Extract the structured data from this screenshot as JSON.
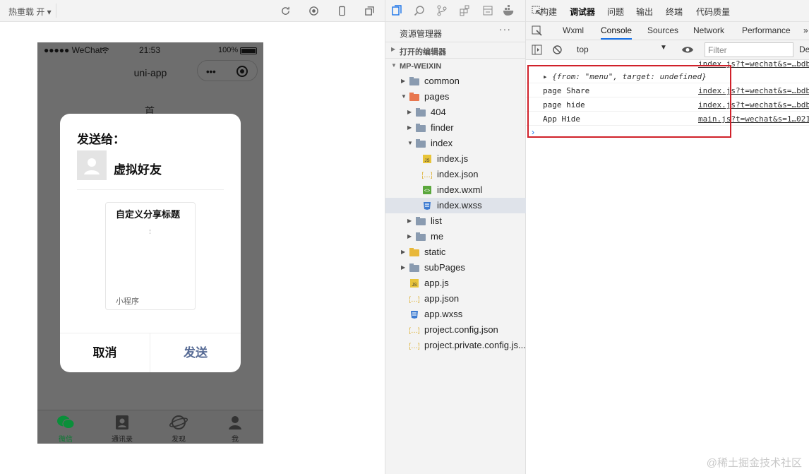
{
  "simulator": {
    "hot_reload": "热重载 开 ▾",
    "phone": {
      "status": {
        "carrier": "●●●●● WeChat",
        "time": "21:53",
        "battery": "100%"
      },
      "nav_title": "uni-app",
      "peek_text": "首",
      "dialog": {
        "title": "发送给：",
        "friend": "虚拟好友",
        "card_title": "自定义分享标题",
        "card_type": "小程序",
        "cancel": "取消",
        "send": "发送"
      },
      "tabbar": [
        {
          "label": "微信",
          "icon": "wechat-icon"
        },
        {
          "label": "通讯录",
          "icon": "contacts-icon"
        },
        {
          "label": "发现",
          "icon": "discover-icon"
        },
        {
          "label": "我",
          "icon": "me-icon"
        }
      ]
    }
  },
  "explorer": {
    "title": "资源管理器",
    "more": "···",
    "open_editors": "打开的编辑器",
    "project": "MP-WEIXIN",
    "tree": [
      {
        "name": "common",
        "depth": 0,
        "type": "folder",
        "open": false
      },
      {
        "name": "pages",
        "depth": 0,
        "type": "folder-special",
        "open": true
      },
      {
        "name": "404",
        "depth": 1,
        "type": "folder",
        "open": false
      },
      {
        "name": "finder",
        "depth": 1,
        "type": "folder",
        "open": false
      },
      {
        "name": "index",
        "depth": 1,
        "type": "folder",
        "open": true
      },
      {
        "name": "index.js",
        "depth": 2,
        "type": "js"
      },
      {
        "name": "index.json",
        "depth": 2,
        "type": "json"
      },
      {
        "name": "index.wxml",
        "depth": 2,
        "type": "wxml"
      },
      {
        "name": "index.wxss",
        "depth": 2,
        "type": "wxss",
        "selected": true
      },
      {
        "name": "list",
        "depth": 1,
        "type": "folder",
        "open": false
      },
      {
        "name": "me",
        "depth": 1,
        "type": "folder",
        "open": false
      },
      {
        "name": "static",
        "depth": 0,
        "type": "folder-yellow",
        "open": false
      },
      {
        "name": "subPages",
        "depth": 0,
        "type": "folder",
        "open": false
      },
      {
        "name": "app.js",
        "depth": 0,
        "type": "js"
      },
      {
        "name": "app.json",
        "depth": 0,
        "type": "json"
      },
      {
        "name": "app.wxss",
        "depth": 0,
        "type": "wxss"
      },
      {
        "name": "project.config.json",
        "depth": 0,
        "type": "json"
      },
      {
        "name": "project.private.config.js...",
        "depth": 0,
        "type": "json"
      }
    ]
  },
  "devtools": {
    "top_tabs": [
      "构建",
      "调试器",
      "问题",
      "输出",
      "终端",
      "代码质量"
    ],
    "tabs": [
      "Wxml",
      "Console",
      "Sources",
      "Network",
      "Performance",
      "»"
    ],
    "active_tab": "Console",
    "context": "top",
    "filter_placeholder": "Filter",
    "default_levels": "De",
    "logs": [
      {
        "message": "▸ {from: \"menu\", target: undefined}",
        "source": "index.js?t=wechat&s=…bdb"
      },
      {
        "message": "page Share",
        "source": "index.js?t=wechat&s=…bdb"
      },
      {
        "message": "page hide",
        "source": "index.js?t=wechat&s=…bdb"
      },
      {
        "message": "App Hide",
        "source": "main.js?t=wechat&s=1…021"
      }
    ],
    "prompt": "›",
    "highlight_color": "#d0212a"
  },
  "watermark": "@稀土掘金技术社区"
}
